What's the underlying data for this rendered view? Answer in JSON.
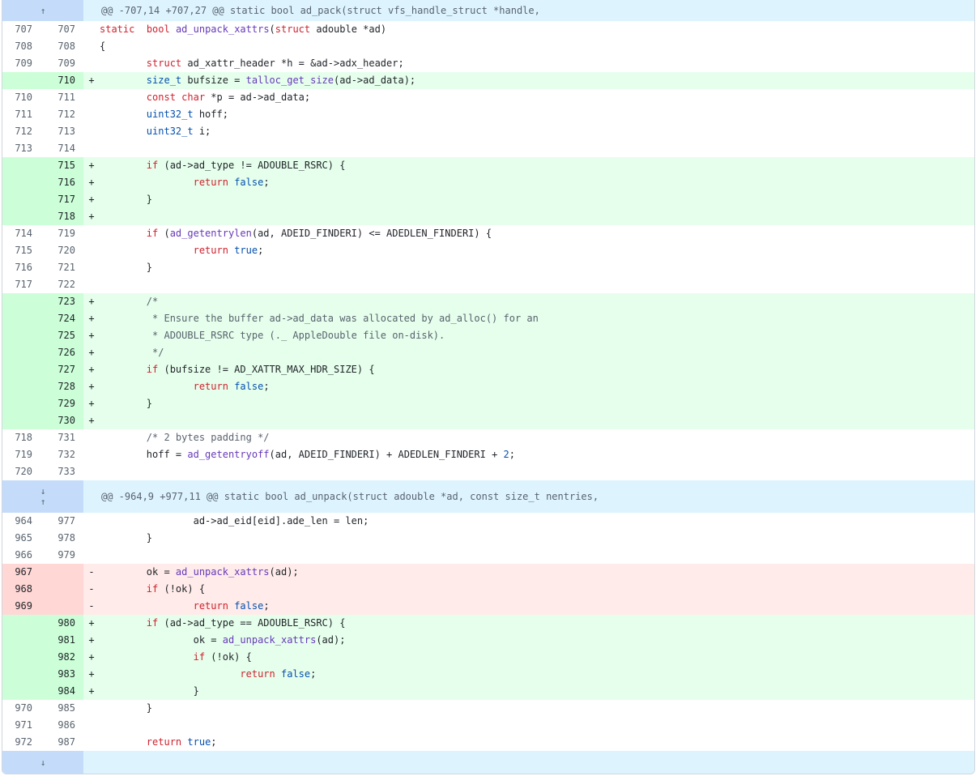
{
  "hunk_headers": [
    "@@ -707,14 +707,27 @@ static bool ad_pack(struct vfs_handle_struct *handle,",
    "@@ -964,9 +977,11 @@ static bool ad_unpack(struct adouble *ad, const size_t nentries,"
  ],
  "icons": {
    "expand_up": "↑",
    "expand_down": "↓"
  },
  "colors": {
    "added_bg": "#e6ffec",
    "added_num_bg": "#ccffd8",
    "removed_bg": "#ffebe9",
    "removed_num_bg": "#ffd7d5",
    "hunk_bg": "#ddf4ff",
    "expander_bg": "#c4dcfa"
  },
  "lines": [
    {
      "old": "707",
      "new": "707",
      "sign": "",
      "tokens": [
        [
          "kw",
          "static"
        ],
        [
          "",
          "  "
        ],
        [
          "kw",
          "bool"
        ],
        [
          "",
          " "
        ],
        [
          "fn",
          "ad_unpack_xattrs"
        ],
        [
          "",
          "("
        ],
        [
          "kw",
          "struct"
        ],
        [
          "",
          " adouble *ad)"
        ]
      ]
    },
    {
      "old": "708",
      "new": "708",
      "sign": "",
      "tokens": [
        [
          "",
          "{"
        ]
      ]
    },
    {
      "old": "709",
      "new": "709",
      "sign": "",
      "tokens": [
        [
          "",
          "        "
        ],
        [
          "kw",
          "struct"
        ],
        [
          "",
          " ad_xattr_header *h = &ad->adx_header;"
        ]
      ]
    },
    {
      "old": "",
      "new": "710",
      "sign": "+",
      "tokens": [
        [
          "",
          "        "
        ],
        [
          "ty",
          "size_t"
        ],
        [
          "",
          " bufsize = "
        ],
        [
          "fn",
          "talloc_get_size"
        ],
        [
          "",
          "(ad->ad_data);"
        ]
      ]
    },
    {
      "old": "710",
      "new": "711",
      "sign": "",
      "tokens": [
        [
          "",
          "        "
        ],
        [
          "kw",
          "const"
        ],
        [
          "",
          " "
        ],
        [
          "kw",
          "char"
        ],
        [
          "",
          " *p = ad->ad_data;"
        ]
      ]
    },
    {
      "old": "711",
      "new": "712",
      "sign": "",
      "tokens": [
        [
          "",
          "        "
        ],
        [
          "ty",
          "uint32_t"
        ],
        [
          "",
          " hoff;"
        ]
      ]
    },
    {
      "old": "712",
      "new": "713",
      "sign": "",
      "tokens": [
        [
          "",
          "        "
        ],
        [
          "ty",
          "uint32_t"
        ],
        [
          "",
          " i;"
        ]
      ]
    },
    {
      "old": "713",
      "new": "714",
      "sign": "",
      "tokens": [
        [
          "",
          ""
        ]
      ]
    },
    {
      "old": "",
      "new": "715",
      "sign": "+",
      "tokens": [
        [
          "",
          "        "
        ],
        [
          "kw",
          "if"
        ],
        [
          "",
          " (ad->ad_type != ADOUBLE_RSRC) {"
        ]
      ]
    },
    {
      "old": "",
      "new": "716",
      "sign": "+",
      "tokens": [
        [
          "",
          "                "
        ],
        [
          "kw",
          "return"
        ],
        [
          "",
          " "
        ],
        [
          "lit",
          "false"
        ],
        [
          "",
          ";"
        ]
      ]
    },
    {
      "old": "",
      "new": "717",
      "sign": "+",
      "tokens": [
        [
          "",
          "        }"
        ]
      ]
    },
    {
      "old": "",
      "new": "718",
      "sign": "+",
      "tokens": [
        [
          "",
          ""
        ]
      ]
    },
    {
      "old": "714",
      "new": "719",
      "sign": "",
      "tokens": [
        [
          "",
          "        "
        ],
        [
          "kw",
          "if"
        ],
        [
          "",
          " ("
        ],
        [
          "fn",
          "ad_getentrylen"
        ],
        [
          "",
          "(ad, ADEID_FINDERI) <= ADEDLEN_FINDERI) {"
        ]
      ]
    },
    {
      "old": "715",
      "new": "720",
      "sign": "",
      "tokens": [
        [
          "",
          "                "
        ],
        [
          "kw",
          "return"
        ],
        [
          "",
          " "
        ],
        [
          "lit",
          "true"
        ],
        [
          "",
          ";"
        ]
      ]
    },
    {
      "old": "716",
      "new": "721",
      "sign": "",
      "tokens": [
        [
          "",
          "        }"
        ]
      ]
    },
    {
      "old": "717",
      "new": "722",
      "sign": "",
      "tokens": [
        [
          "",
          ""
        ]
      ]
    },
    {
      "old": "",
      "new": "723",
      "sign": "+",
      "tokens": [
        [
          "",
          "        "
        ],
        [
          "cm",
          "/*"
        ]
      ]
    },
    {
      "old": "",
      "new": "724",
      "sign": "+",
      "tokens": [
        [
          "",
          "        "
        ],
        [
          "cm",
          " * Ensure the buffer ad->ad_data was allocated by ad_alloc() for an"
        ]
      ]
    },
    {
      "old": "",
      "new": "725",
      "sign": "+",
      "tokens": [
        [
          "",
          "        "
        ],
        [
          "cm",
          " * ADOUBLE_RSRC type (._ AppleDouble file on-disk)."
        ]
      ]
    },
    {
      "old": "",
      "new": "726",
      "sign": "+",
      "tokens": [
        [
          "",
          "        "
        ],
        [
          "cm",
          " */"
        ]
      ]
    },
    {
      "old": "",
      "new": "727",
      "sign": "+",
      "tokens": [
        [
          "",
          "        "
        ],
        [
          "kw",
          "if"
        ],
        [
          "",
          " (bufsize != AD_XATTR_MAX_HDR_SIZE) {"
        ]
      ]
    },
    {
      "old": "",
      "new": "728",
      "sign": "+",
      "tokens": [
        [
          "",
          "                "
        ],
        [
          "kw",
          "return"
        ],
        [
          "",
          " "
        ],
        [
          "lit",
          "false"
        ],
        [
          "",
          ";"
        ]
      ]
    },
    {
      "old": "",
      "new": "729",
      "sign": "+",
      "tokens": [
        [
          "",
          "        }"
        ]
      ]
    },
    {
      "old": "",
      "new": "730",
      "sign": "+",
      "tokens": [
        [
          "",
          ""
        ]
      ]
    },
    {
      "old": "718",
      "new": "731",
      "sign": "",
      "tokens": [
        [
          "",
          "        "
        ],
        [
          "cm",
          "/* 2 bytes padding */"
        ]
      ]
    },
    {
      "old": "719",
      "new": "732",
      "sign": "",
      "tokens": [
        [
          "",
          "        hoff = "
        ],
        [
          "fn",
          "ad_getentryoff"
        ],
        [
          "",
          "(ad, ADEID_FINDERI) + ADEDLEN_FINDERI + "
        ],
        [
          "lit",
          "2"
        ],
        [
          "",
          ";"
        ]
      ]
    },
    {
      "old": "720",
      "new": "733",
      "sign": "",
      "tokens": [
        [
          "",
          ""
        ]
      ]
    },
    {
      "old": "964",
      "new": "977",
      "sign": "",
      "tokens": [
        [
          "",
          "                ad->ad_eid[eid].ade_len = len;"
        ]
      ]
    },
    {
      "old": "965",
      "new": "978",
      "sign": "",
      "tokens": [
        [
          "",
          "        }"
        ]
      ]
    },
    {
      "old": "966",
      "new": "979",
      "sign": "",
      "tokens": [
        [
          "",
          ""
        ]
      ]
    },
    {
      "old": "967",
      "new": "",
      "sign": "-",
      "tokens": [
        [
          "",
          "        ok = "
        ],
        [
          "fn",
          "ad_unpack_xattrs"
        ],
        [
          "",
          "(ad);"
        ]
      ]
    },
    {
      "old": "968",
      "new": "",
      "sign": "-",
      "tokens": [
        [
          "",
          "        "
        ],
        [
          "kw",
          "if"
        ],
        [
          "",
          " (!ok) {"
        ]
      ]
    },
    {
      "old": "969",
      "new": "",
      "sign": "-",
      "tokens": [
        [
          "",
          "                "
        ],
        [
          "kw",
          "return"
        ],
        [
          "",
          " "
        ],
        [
          "lit",
          "false"
        ],
        [
          "",
          ";"
        ]
      ]
    },
    {
      "old": "",
      "new": "980",
      "sign": "+",
      "tokens": [
        [
          "",
          "        "
        ],
        [
          "kw",
          "if"
        ],
        [
          "",
          " (ad->ad_type == ADOUBLE_RSRC) {"
        ]
      ]
    },
    {
      "old": "",
      "new": "981",
      "sign": "+",
      "tokens": [
        [
          "",
          "                ok = "
        ],
        [
          "fn",
          "ad_unpack_xattrs"
        ],
        [
          "",
          "(ad);"
        ]
      ]
    },
    {
      "old": "",
      "new": "982",
      "sign": "+",
      "tokens": [
        [
          "",
          "                "
        ],
        [
          "kw",
          "if"
        ],
        [
          "",
          " (!ok) {"
        ]
      ]
    },
    {
      "old": "",
      "new": "983",
      "sign": "+",
      "tokens": [
        [
          "",
          "                        "
        ],
        [
          "kw",
          "return"
        ],
        [
          "",
          " "
        ],
        [
          "lit",
          "false"
        ],
        [
          "",
          ";"
        ]
      ]
    },
    {
      "old": "",
      "new": "984",
      "sign": "+",
      "tokens": [
        [
          "",
          "                }"
        ]
      ]
    },
    {
      "old": "970",
      "new": "985",
      "sign": "",
      "tokens": [
        [
          "",
          "        }"
        ]
      ]
    },
    {
      "old": "971",
      "new": "986",
      "sign": "",
      "tokens": [
        [
          "",
          ""
        ]
      ]
    },
    {
      "old": "972",
      "new": "987",
      "sign": "",
      "tokens": [
        [
          "",
          "        "
        ],
        [
          "kw",
          "return"
        ],
        [
          "",
          " "
        ],
        [
          "lit",
          "true"
        ],
        [
          "",
          ";"
        ]
      ]
    }
  ]
}
